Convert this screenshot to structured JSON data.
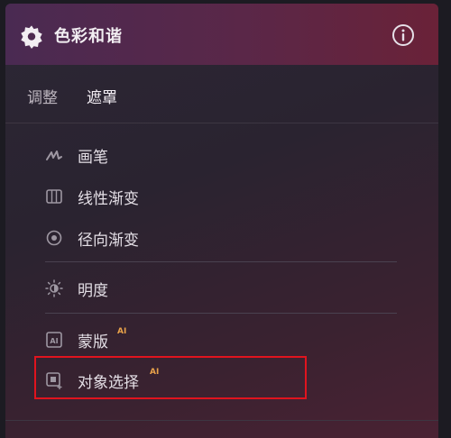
{
  "header": {
    "title": "色彩和谐",
    "gear_icon": "gear-icon",
    "info_icon": "info-icon"
  },
  "tabs": [
    {
      "label": "调整"
    },
    {
      "label": "遮罩"
    }
  ],
  "tools": [
    {
      "label": "画笔",
      "icon": "brush-icon"
    },
    {
      "label": "线性渐变",
      "icon": "linear-gradient-icon"
    },
    {
      "label": "径向渐变",
      "icon": "radial-gradient-icon"
    },
    {
      "label": "明度",
      "icon": "luminance-icon"
    },
    {
      "label": "蒙版",
      "icon": "ai-mask-icon",
      "badge": "AI"
    },
    {
      "label": "对象选择",
      "icon": "object-select-icon",
      "badge": "AI"
    }
  ],
  "colors": {
    "accent_badge": "#e9a24a",
    "highlight": "#e0141e"
  }
}
